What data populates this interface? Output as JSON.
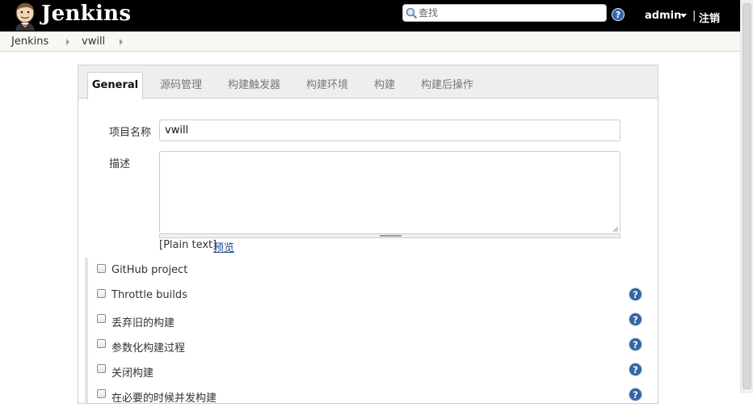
{
  "header": {
    "app_name": "Jenkins",
    "search_placeholder": "查找",
    "user": "admin",
    "separator": "|",
    "logout": "注销"
  },
  "breadcrumb": [
    "Jenkins",
    "vwill"
  ],
  "tabs": [
    {
      "label": "General",
      "active": true
    },
    {
      "label": "源码管理"
    },
    {
      "label": "构建触发器"
    },
    {
      "label": "构建环境"
    },
    {
      "label": "构建"
    },
    {
      "label": "构建后操作"
    }
  ],
  "form": {
    "project_name_label": "项目名称",
    "project_name_value": "vwill",
    "description_label": "描述",
    "description_value": "",
    "plain_text": "[Plain text]",
    "preview": "预览"
  },
  "options": [
    {
      "label": "GitHub project",
      "checked": false,
      "help": false
    },
    {
      "label": "Throttle builds",
      "checked": false,
      "help": true
    },
    {
      "label": "丢弃旧的构建",
      "checked": false,
      "help": true
    },
    {
      "label": "参数化构建过程",
      "checked": false,
      "help": true
    },
    {
      "label": "关闭构建",
      "checked": false,
      "help": true
    },
    {
      "label": "在必要的时候并发构建",
      "checked": false,
      "help": true
    }
  ],
  "colors": {
    "header_bg": "#000000",
    "help_icon": "#3465a4",
    "link": "#204a87"
  },
  "icons": {
    "logo": "jenkins-butler-icon",
    "search": "magnifier-icon",
    "help": "question-mark-icon"
  }
}
